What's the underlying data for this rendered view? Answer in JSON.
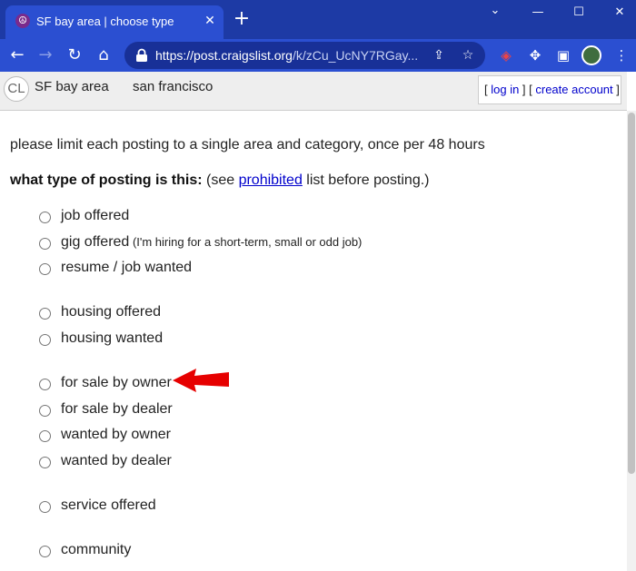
{
  "browser": {
    "tab_title": "SF bay area | choose type",
    "url_host": "https://post.craigslist.org",
    "url_path": "/k/zCu_UcNY7RGay...",
    "tab_close_glyph": "✕",
    "new_tab_glyph": "+",
    "window_controls": {
      "minimize": "—",
      "maximize": "☐",
      "close": "✕",
      "dropdown": "⌄"
    }
  },
  "header": {
    "logo": "CL",
    "area": "SF bay area",
    "subarea": "san francisco",
    "bracket_open": "[ ",
    "login": "log in",
    "bracket_mid": " ] [ ",
    "create_account": "create account",
    "bracket_close": " ]"
  },
  "notice": "please limit each posting to a single area and category, once per 48 hours",
  "question": {
    "bold": "what type of posting is this:",
    "pre_link": " (see ",
    "link": "prohibited",
    "post_link": " list before posting.)"
  },
  "options": [
    {
      "label": "job offered",
      "note": ""
    },
    {
      "label": "gig offered",
      "note": " (I'm hiring for a short-term, small or odd job)"
    },
    {
      "label": "resume / job wanted",
      "note": ""
    },
    {
      "label": "housing offered",
      "note": ""
    },
    {
      "label": "housing wanted",
      "note": ""
    },
    {
      "label": "for sale by owner",
      "note": ""
    },
    {
      "label": "for sale by dealer",
      "note": ""
    },
    {
      "label": "wanted by owner",
      "note": ""
    },
    {
      "label": "wanted by dealer",
      "note": ""
    },
    {
      "label": "service offered",
      "note": ""
    },
    {
      "label": "community",
      "note": ""
    }
  ],
  "colors": {
    "browser_frame": "#1d3aa5",
    "toolbar": "#2b4fd1",
    "link": "#0000cc",
    "annotation_arrow": "#e60000"
  }
}
